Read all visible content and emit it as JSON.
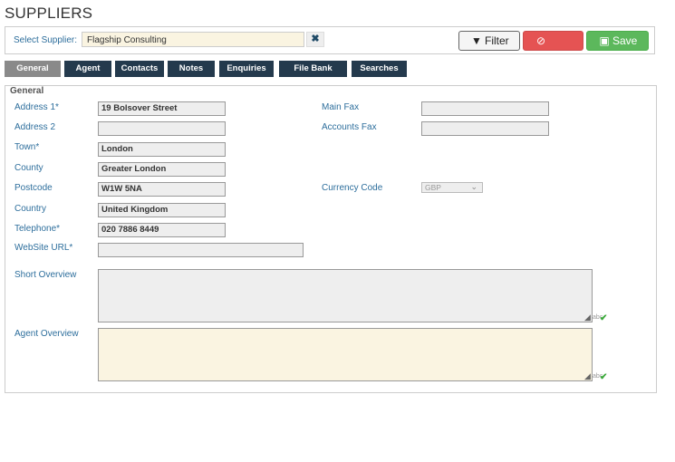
{
  "page_title": "SUPPLIERS",
  "supplier_select": {
    "label": "Select Supplier:",
    "value": "Flagship Consulting",
    "clear_icon": "close-icon"
  },
  "buttons": {
    "filter": "Filter",
    "cancel": "Cancel",
    "save": "Save"
  },
  "tabs": [
    "General",
    "Agent",
    "Contacts",
    "Notes",
    "Enquiries",
    "File Bank",
    "Searches"
  ],
  "active_tab": "General",
  "section_title": "General",
  "fields": {
    "address1": {
      "label": "Address 1*",
      "value": "19 Bolsover Street"
    },
    "address2": {
      "label": "Address 2",
      "value": ""
    },
    "town": {
      "label": "Town*",
      "value": "London"
    },
    "county": {
      "label": "County",
      "value": "Greater London"
    },
    "postcode": {
      "label": "Postcode",
      "value": "W1W 5NA"
    },
    "country": {
      "label": "Country",
      "value": "United Kingdom"
    },
    "telephone": {
      "label": "Telephone*",
      "value": "020 7886 8449"
    },
    "website": {
      "label": "WebSite URL*",
      "value": ""
    },
    "main_fax": {
      "label": "Main Fax",
      "value": ""
    },
    "accounts_fax": {
      "label": "Accounts Fax",
      "value": ""
    },
    "currency": {
      "label": "Currency Code",
      "value": "GBP"
    },
    "short_overview": {
      "label": "Short Overview",
      "value": ""
    },
    "agent_overview": {
      "label": "Agent Overview",
      "value": ""
    }
  },
  "colors": {
    "accent_label": "#2d6e9c",
    "tab_bg": "#243a4d",
    "tab_active": "#8a8a8a",
    "cancel": "#e55353",
    "save": "#5cb85c",
    "highlight": "#faf4e1"
  }
}
